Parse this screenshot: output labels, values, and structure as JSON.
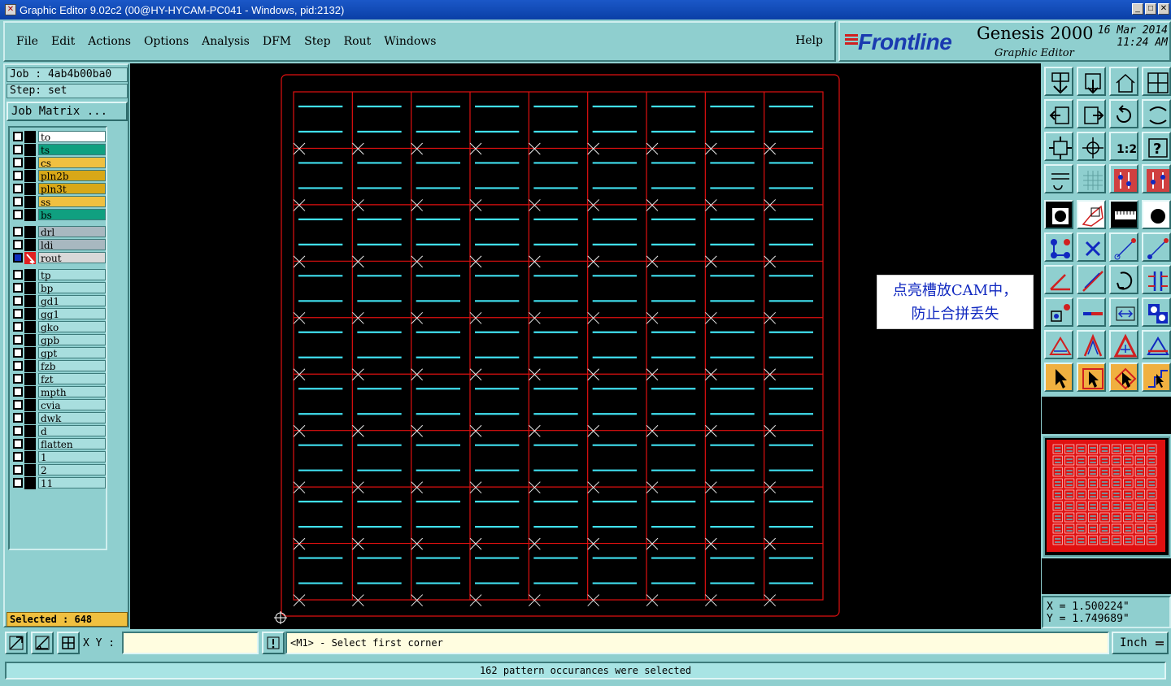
{
  "window": {
    "title": "Graphic Editor 9.02c2 (00@HY-HYCAM-PC041 - Windows, pid:2132)",
    "buttons": [
      "_",
      "□",
      "✕"
    ]
  },
  "menu": {
    "items": [
      "File",
      "Edit",
      "Actions",
      "Options",
      "Analysis",
      "DFM",
      "Step",
      "Rout",
      "Windows"
    ],
    "help": "Help"
  },
  "brand": {
    "logo": "Frontline",
    "product": "Genesis 2000",
    "subtitle": "Graphic Editor",
    "date": "16 Mar 2014",
    "time": "11:24 AM"
  },
  "job": {
    "job_label": "Job : 4ab4b00ba0",
    "step_label": "Step: set",
    "job_matrix_button": "Job Matrix ..."
  },
  "layers": [
    {
      "name": "to",
      "color": "#ffffff",
      "group": 0,
      "selected": false,
      "editing": false
    },
    {
      "name": "ts",
      "color": "#10a080",
      "group": 0,
      "selected": false,
      "editing": false
    },
    {
      "name": "cs",
      "color": "#f0c040",
      "group": 0,
      "selected": false,
      "editing": false
    },
    {
      "name": "pln2b",
      "color": "#d8a818",
      "group": 0,
      "selected": false,
      "editing": false
    },
    {
      "name": "pln3t",
      "color": "#d8a818",
      "group": 0,
      "selected": false,
      "editing": false
    },
    {
      "name": "ss",
      "color": "#f0c040",
      "group": 0,
      "selected": false,
      "editing": false
    },
    {
      "name": "bs",
      "color": "#10a080",
      "group": 0,
      "selected": false,
      "editing": false
    },
    {
      "name": "drl",
      "color": "#a8b8c0",
      "group": 1,
      "selected": false,
      "editing": false
    },
    {
      "name": "ldi",
      "color": "#a8b8c0",
      "group": 1,
      "selected": false,
      "editing": false
    },
    {
      "name": "rout",
      "color": "#d8d8d8",
      "group": 1,
      "selected": true,
      "editing": true
    },
    {
      "name": "tp",
      "color": "#a8dede",
      "group": 2,
      "selected": false,
      "editing": false
    },
    {
      "name": "bp",
      "color": "#a8dede",
      "group": 2,
      "selected": false,
      "editing": false
    },
    {
      "name": "gd1",
      "color": "#a8dede",
      "group": 2,
      "selected": false,
      "editing": false
    },
    {
      "name": "gg1",
      "color": "#a8dede",
      "group": 2,
      "selected": false,
      "editing": false
    },
    {
      "name": "gko",
      "color": "#a8dede",
      "group": 2,
      "selected": false,
      "editing": false
    },
    {
      "name": "gpb",
      "color": "#a8dede",
      "group": 2,
      "selected": false,
      "editing": false
    },
    {
      "name": "gpt",
      "color": "#a8dede",
      "group": 2,
      "selected": false,
      "editing": false
    },
    {
      "name": "fzb",
      "color": "#a8dede",
      "group": 2,
      "selected": false,
      "editing": false
    },
    {
      "name": "fzt",
      "color": "#a8dede",
      "group": 2,
      "selected": false,
      "editing": false
    },
    {
      "name": "mpth",
      "color": "#a8dede",
      "group": 2,
      "selected": false,
      "editing": false
    },
    {
      "name": "cvia",
      "color": "#a8dede",
      "group": 2,
      "selected": false,
      "editing": false
    },
    {
      "name": "dwk",
      "color": "#a8dede",
      "group": 2,
      "selected": false,
      "editing": false
    },
    {
      "name": "d",
      "color": "#a8dede",
      "group": 2,
      "selected": false,
      "editing": false
    },
    {
      "name": "flatten",
      "color": "#a8dede",
      "group": 2,
      "selected": false,
      "editing": false
    },
    {
      "name": "1",
      "color": "#a8dede",
      "group": 2,
      "selected": false,
      "editing": false
    },
    {
      "name": "2",
      "color": "#a8dede",
      "group": 2,
      "selected": false,
      "editing": false
    },
    {
      "name": "11",
      "color": "#a8dede",
      "group": 2,
      "selected": false,
      "editing": false
    }
  ],
  "selection": {
    "label": "Selected : 648"
  },
  "canvas": {
    "note_line1": "点亮槽放CAM中，",
    "note_line2": "防止合拼丢失",
    "panel_columns": 9,
    "panel_rows": 9,
    "slots_per_cell": 2,
    "outline_color": "#e01010",
    "slot_color": "#40e0f0",
    "marker_color": "#e8e8e8"
  },
  "coordinates": {
    "x": "X = 1.500224\"",
    "y": "Y = 1.749689\""
  },
  "bottom": {
    "xy_label": "X Y :",
    "xy_value": "",
    "prompt": "<M1> - Select first corner",
    "units": "Inch",
    "status": "162 pattern occurances were selected"
  },
  "colors": {
    "panel_bg": "#8fcfcf",
    "canvas_bg": "#000000",
    "accent_blue": "#1028c0"
  }
}
